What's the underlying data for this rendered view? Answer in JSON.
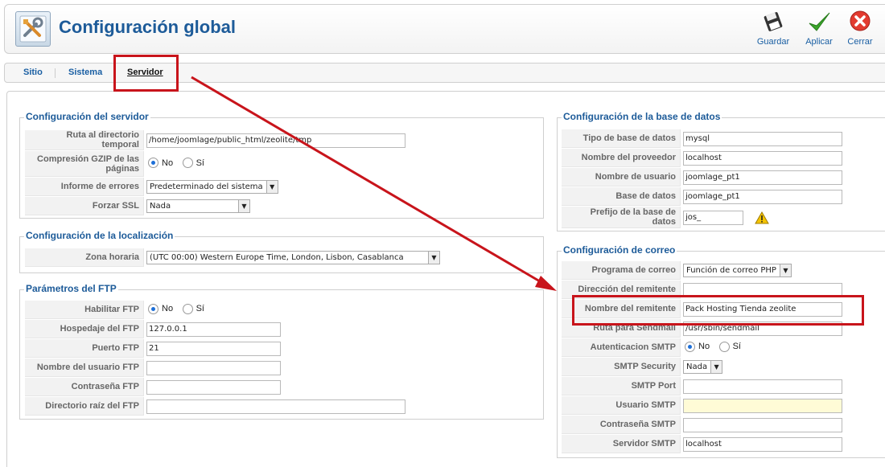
{
  "header": {
    "title": "Configuración global",
    "toolbar": [
      {
        "id": "save",
        "label": "Guardar",
        "icon": "floppy-disk-icon"
      },
      {
        "id": "apply",
        "label": "Aplicar",
        "icon": "checkmark-icon"
      },
      {
        "id": "close",
        "label": "Cerrar",
        "icon": "close-circle-icon"
      }
    ]
  },
  "tabs": [
    {
      "label": "Sitio",
      "active": false
    },
    {
      "label": "Sistema",
      "active": false
    },
    {
      "label": "Servidor",
      "active": true
    }
  ],
  "server": {
    "legend": "Configuración del servidor",
    "temp_path": {
      "label": "Ruta al directorio temporal",
      "value": "/home/joomlage/public_html/zeolite/tmp"
    },
    "gzip": {
      "label": "Compresión GZIP de las páginas",
      "options": [
        "No",
        "Sí"
      ],
      "selected": "No"
    },
    "error_report": {
      "label": "Informe de errores",
      "value": "Predeterminado del sistema"
    },
    "force_ssl": {
      "label": "Forzar SSL",
      "value": "Nada"
    }
  },
  "locale": {
    "legend": "Configuración de la localización",
    "timezone": {
      "label": "Zona horaria",
      "value": "(UTC 00:00) Western Europe Time, London, Lisbon, Casablanca"
    }
  },
  "ftp": {
    "legend": "Parámetros del FTP",
    "enable": {
      "label": "Habilitar FTP",
      "options": [
        "No",
        "Sí"
      ],
      "selected": "No"
    },
    "host": {
      "label": "Hospedaje del FTP",
      "value": "127.0.0.1"
    },
    "port": {
      "label": "Puerto FTP",
      "value": "21"
    },
    "user": {
      "label": "Nombre del usuario FTP",
      "value": ""
    },
    "password": {
      "label": "Contraseña FTP",
      "value": ""
    },
    "root": {
      "label": "Directorio raíz del FTP",
      "value": ""
    }
  },
  "database": {
    "legend": "Configuración de la base de datos",
    "type": {
      "label": "Tipo de base de datos",
      "value": "mysql"
    },
    "host": {
      "label": "Nombre del proveedor",
      "value": "localhost"
    },
    "user": {
      "label": "Nombre de usuario",
      "value": "joomlage_pt1"
    },
    "name": {
      "label": "Base de datos",
      "value": "joomlage_pt1"
    },
    "prefix": {
      "label": "Prefijo de la base de datos",
      "value": "jos_",
      "icon": "warning-icon"
    }
  },
  "mail": {
    "legend": "Configuración de correo",
    "mailer": {
      "label": "Programa de correo",
      "value": "Función de correo PHP"
    },
    "from_email": {
      "label": "Dirección del remitente",
      "value": ""
    },
    "from_name": {
      "label": "Nombre del remitente",
      "value": "Pack Hosting Tienda zeolite"
    },
    "sendmail": {
      "label": "Ruta para Sendmail",
      "value": "/usr/sbin/sendmail"
    },
    "smtp_auth": {
      "label": "Autenticacion SMTP",
      "options": [
        "No",
        "Sí"
      ],
      "selected": "No"
    },
    "smtp_security": {
      "label": "SMTP Security",
      "value": "Nada"
    },
    "smtp_port": {
      "label": "SMTP Port",
      "value": ""
    },
    "smtp_user": {
      "label": "Usuario SMTP",
      "value": ""
    },
    "smtp_pass": {
      "label": "Contraseña SMTP",
      "value": ""
    },
    "smtp_host": {
      "label": "Servidor SMTP",
      "value": "localhost"
    }
  },
  "colors": {
    "title": "#1d5b99",
    "link": "#1a5fa3",
    "annotation": "#c8141b",
    "highlight_field": "#fffbd6"
  }
}
